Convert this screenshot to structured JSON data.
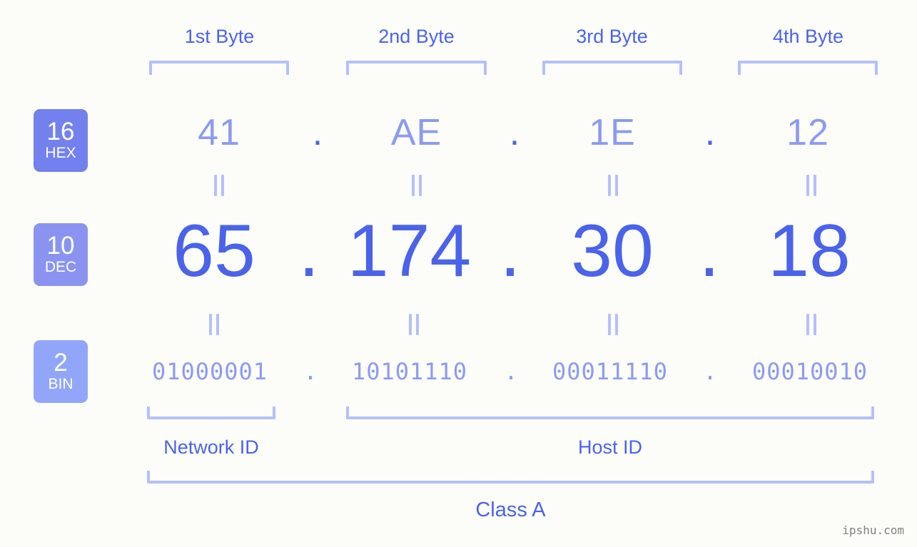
{
  "background_color": "#fcfdf8",
  "accent_color": "#4a63ea",
  "muted_accent_color": "#8c9af0",
  "bracket_color": "#b4c0fb",
  "byte_headers": [
    {
      "label": "1st Byte"
    },
    {
      "label": "2nd Byte"
    },
    {
      "label": "3rd Byte"
    },
    {
      "label": "4th Byte"
    }
  ],
  "rows": {
    "hex": {
      "badge_base": "16",
      "badge_name": "HEX",
      "badge_color": "#7381ee",
      "values": [
        "41",
        "AE",
        "1E",
        "12"
      ],
      "separator": "."
    },
    "dec": {
      "badge_base": "10",
      "badge_name": "DEC",
      "badge_color": "#8a94f0",
      "values": [
        "65",
        "174",
        "30",
        "18"
      ],
      "separator": "."
    },
    "bin": {
      "badge_base": "2",
      "badge_name": "BIN",
      "badge_color": "#92a6f9",
      "values": [
        "01000001",
        "10101110",
        "00011110",
        "00010010"
      ],
      "separator": "."
    }
  },
  "equality_marks": {
    "hex_to_dec_count": 4,
    "dec_to_bin_count": 4,
    "glyph": "="
  },
  "footer": {
    "network_id_label": "Network ID",
    "host_id_label": "Host ID",
    "class_label": "Class A"
  },
  "watermark": "ipshu.com"
}
